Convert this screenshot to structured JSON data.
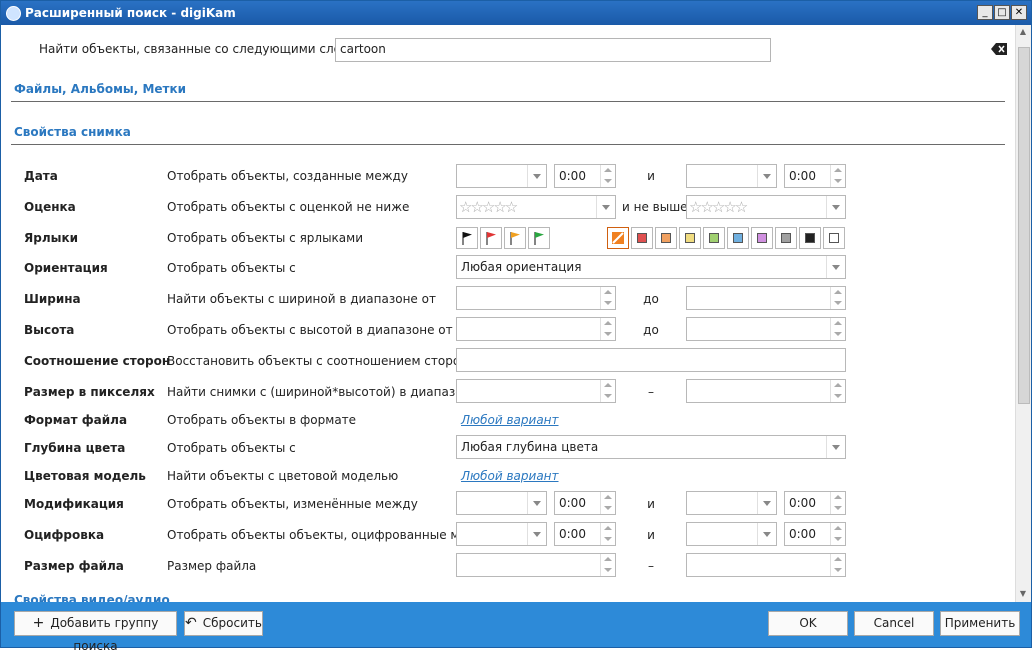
{
  "window": {
    "title": "Расширенный поиск - digiKam"
  },
  "search": {
    "label": "Найти объекты, связанные со следующими словами:",
    "value": "cartoon"
  },
  "sections": {
    "files": "Файлы, Альбомы, Метки",
    "photo": "Свойства снимка",
    "video": "Свойства видео/аудио"
  },
  "rows": {
    "date": {
      "label": "Дата",
      "desc": "Отобрать объекты, созданные между",
      "time1": "0:00",
      "and": "и",
      "time2": "0:00"
    },
    "rating": {
      "label": "Оценка",
      "desc": "Отобрать объекты с оценкой не ниже",
      "and": "и не выше",
      "stars": "☆☆☆☆☆"
    },
    "labels": {
      "label": "Ярлыки",
      "desc": "Отобрать объекты с ярлыками"
    },
    "orientation": {
      "label": "Ориентация",
      "desc": "Отобрать объекты с",
      "value": "Любая ориентация"
    },
    "width": {
      "label": "Ширина",
      "desc": "Найти объекты с шириной в диапазоне от",
      "to": "до"
    },
    "height": {
      "label": "Высота",
      "desc": "Отобрать объекты с высотой в диапазоне от",
      "to": "до"
    },
    "aspect": {
      "label": "Соотношение сторон",
      "desc": "Восстановить объекты с соотношением сторон"
    },
    "pixelsize": {
      "label": "Размер в пикселях",
      "desc": "Найти снимки с (шириной*высотой) в диапазоне",
      "dash": "–"
    },
    "format": {
      "label": "Формат файла",
      "desc": "Отобрать объекты в формате",
      "link": "Любой вариант"
    },
    "depth": {
      "label": "Глубина цвета",
      "desc": "Отобрать объекты с",
      "value": "Любая глубина цвета"
    },
    "colormodel": {
      "label": "Цветовая модель",
      "desc": "Найти объекты с цветовой моделью",
      "link": "Любой вариант"
    },
    "modified": {
      "label": "Модификация",
      "desc": "Отобрать объекты, изменённые между",
      "time1": "0:00",
      "and": "и",
      "time2": "0:00"
    },
    "digitized": {
      "label": "Оцифровка",
      "desc": "Отобрать объекты объекты, оцифрованные между",
      "time1": "0:00",
      "and": "и",
      "time2": "0:00"
    },
    "filesize": {
      "label": "Размер файла",
      "desc": "Размер файла",
      "dash": "–"
    }
  },
  "flag_colors": [
    "#111111",
    "#e03535",
    "#f0a020",
    "#2aa640"
  ],
  "color_labels": [
    "#e05050",
    "#f0a060",
    "#f0dc80",
    "#a0d070",
    "#70b0e0",
    "#d090e0",
    "#a0a0a0",
    "#222222",
    "#ffffff"
  ],
  "footer": {
    "add_group": "Добавить группу поиска",
    "reset": "Сбросить",
    "ok": "OK",
    "cancel": "Cancel",
    "apply": "Применить"
  }
}
